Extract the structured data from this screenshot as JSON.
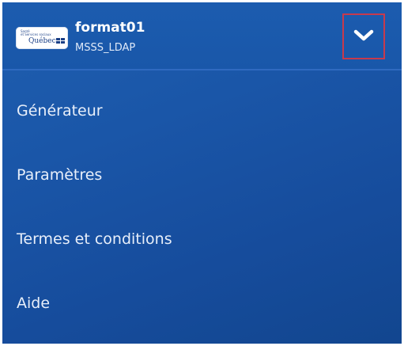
{
  "header": {
    "logo": {
      "fine_print": [
        "Santé",
        "et Services sociaux"
      ],
      "wordmark": "Québec"
    },
    "title": "format01",
    "subtitle": "MSSS_LDAP",
    "toggle_icon": "chevron-down-icon"
  },
  "menu": {
    "items": [
      {
        "label": "Générateur"
      },
      {
        "label": "Paramètres"
      },
      {
        "label": "Termes et conditions"
      },
      {
        "label": "Aide"
      }
    ]
  },
  "colors": {
    "panel_blue": "#1a56a8",
    "highlight_border": "#c73a4d",
    "text": "#ffffff"
  }
}
